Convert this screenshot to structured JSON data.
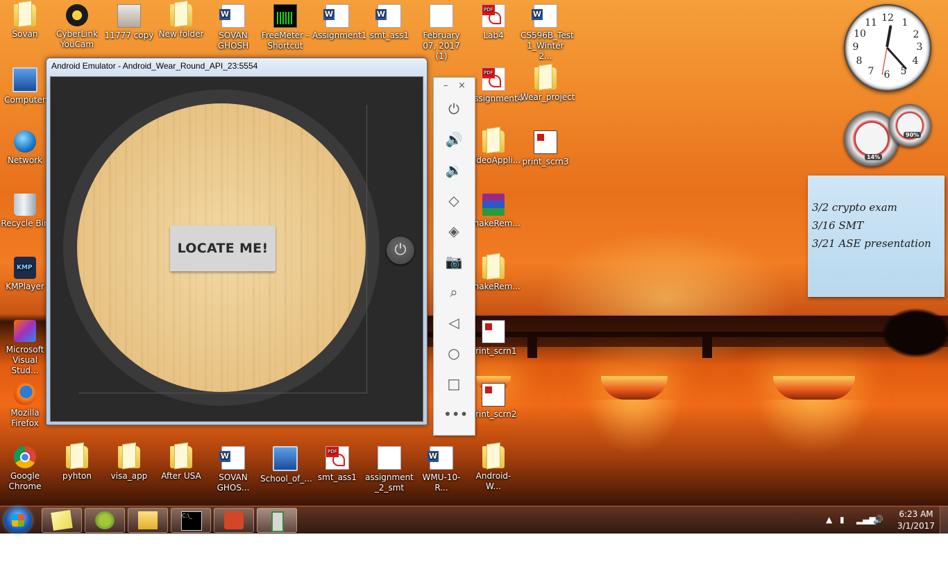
{
  "desktop_icons": {
    "row0": [
      "Sovan",
      "CyberLink YouCam",
      "11777 copy",
      "New folder",
      "SOVAN GHOSH",
      "FreeMeter - Shortcut",
      "Assignment1",
      "smt_ass1",
      "February 07, 2017 (1)",
      "Lab4",
      "CS596B_Test 1_Winter 2..."
    ],
    "col0": [
      "Computer",
      "Network",
      "Recycle Bin",
      "KMPlayer",
      "Microsoft Visual Stud...",
      "Mozilla Firefox"
    ],
    "mid": [
      "Assignment4",
      "Wear_project",
      "VideoAppli...",
      "print_scrn3",
      "SnakeRem...",
      "SnakeRem...",
      "print_scrn1",
      "print_scrn2"
    ],
    "bottom": [
      "Google Chrome",
      "pyhton",
      "visa_app",
      "After USA",
      "SOVAN GHOS...",
      "School_of_...",
      "smt_ass1",
      "assignment _2_smt",
      "WMU-10-R...",
      "Android-W..."
    ]
  },
  "emulator": {
    "title": "Android Emulator - Android_Wear_Round_API_23:5554",
    "button_label": "LOCATE ME!"
  },
  "toolbar": {
    "minimize": "–",
    "close": "×",
    "icons": [
      "power-icon",
      "volume-up-icon",
      "volume-down-icon",
      "rotate-left-icon",
      "rotate-right-icon",
      "camera-icon",
      "zoom-icon",
      "back-icon",
      "home-icon",
      "overview-icon",
      "more-icon"
    ]
  },
  "clock_gadget": {
    "numbers": [
      "12",
      "1",
      "2",
      "3",
      "4",
      "5",
      "6",
      "7",
      "8",
      "9",
      "10",
      "11"
    ]
  },
  "meter_gadget": {
    "cpu": "14%",
    "memory": "90%"
  },
  "sticky_note": {
    "lines": [
      "3/2 crypto exam",
      "3/16 SMT",
      "3/21 ASE presentation"
    ]
  },
  "taskbar": {
    "time": "6:23 AM",
    "date": "3/1/2017"
  }
}
